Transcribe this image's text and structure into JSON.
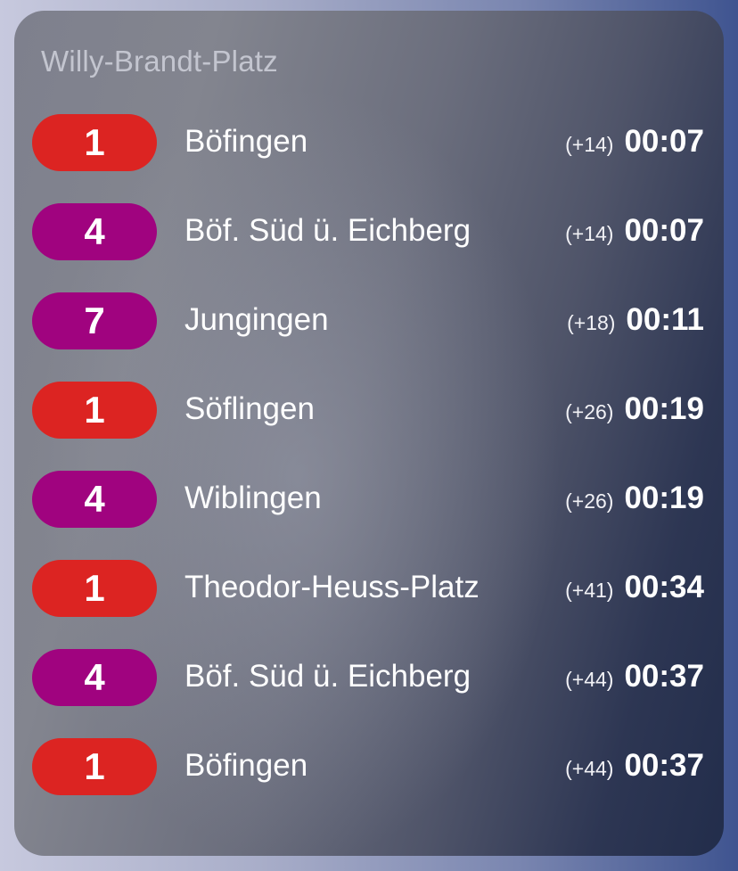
{
  "station": {
    "name": "Willy-Brandt-Platz"
  },
  "colors": {
    "line_1": "#dc2422",
    "line_4": "#a0037f",
    "line_7": "#a0037f"
  },
  "departures": [
    {
      "line": "1",
      "destination": "Böfingen",
      "delay": "(+14)",
      "time": "00:07"
    },
    {
      "line": "4",
      "destination": "Böf. Süd ü. Eichberg",
      "delay": "(+14)",
      "time": "00:07"
    },
    {
      "line": "7",
      "destination": "Jungingen",
      "delay": "(+18)",
      "time": "00:11"
    },
    {
      "line": "1",
      "destination": "Söflingen",
      "delay": "(+26)",
      "time": "00:19"
    },
    {
      "line": "4",
      "destination": "Wiblingen",
      "delay": "(+26)",
      "time": "00:19"
    },
    {
      "line": "1",
      "destination": "Theodor-Heuss-Platz",
      "delay": "(+41)",
      "time": "00:34"
    },
    {
      "line": "4",
      "destination": "Böf. Süd ü. Eichberg",
      "delay": "(+44)",
      "time": "00:37"
    },
    {
      "line": "1",
      "destination": "Böfingen",
      "delay": "(+44)",
      "time": "00:37"
    }
  ]
}
